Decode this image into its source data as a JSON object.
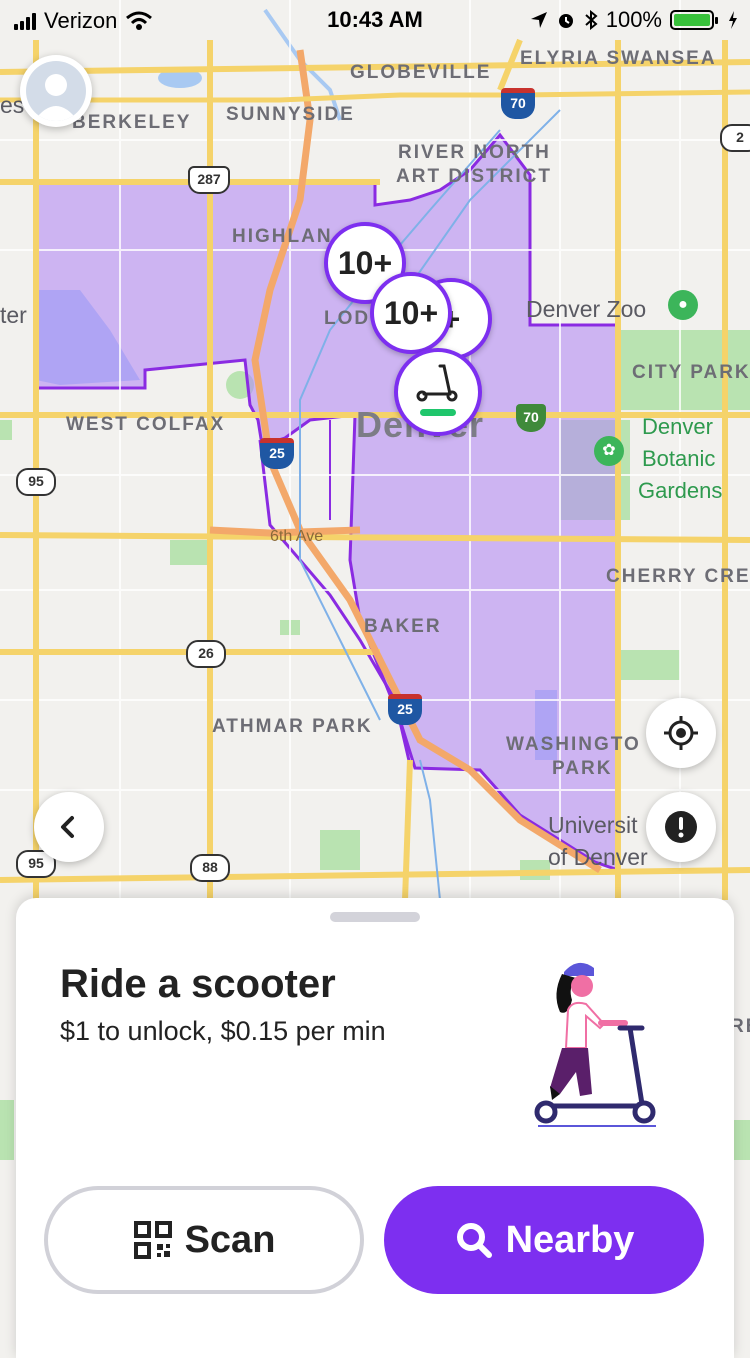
{
  "status_bar": {
    "carrier": "Verizon",
    "time": "10:43 AM",
    "battery_percent": "100%",
    "battery_level": 1.0,
    "icons": [
      "signal-icon",
      "wifi-icon",
      "location-arrow-icon",
      "alarm-icon",
      "bluetooth-icon",
      "battery-icon",
      "charging-icon"
    ]
  },
  "map": {
    "labels": {
      "globeville": "GLOBEVILLE",
      "elyria": "ELYRIA SWANSEA",
      "sunnyside": "SUNNYSIDE",
      "berkeley": "BERKELEY",
      "es": "es",
      "river_north_1": "RIVER NORTH",
      "river_north_2": "ART DISTRICT",
      "highland": "HIGHLAN",
      "lodo": "LOD",
      "ter": "ter",
      "denver_zoo": "Denver Zoo",
      "city_park": "CITY PARK",
      "west_colfax": "WEST COLFAX",
      "denver": "Denver",
      "botanic_1": "Denver",
      "botanic_2": "Botanic",
      "botanic_3": "Gardens",
      "sixth_ave": "6th Ave",
      "cherry_creek": "CHERRY CRE",
      "baker": "BAKER",
      "athmar_park": "ATHMAR PARK",
      "washington_1": "WASHINGTO",
      "washington_2": "PARK",
      "university_1": "Universit",
      "university_2": "of Denver",
      "edge_re": "RE"
    },
    "shields": {
      "us287": "287",
      "i70_top": "70",
      "i70_mid": "70",
      "i25_top": "25",
      "i25_bottom": "25",
      "sh95_top": "95",
      "sh95_bottom": "95",
      "sh26": "26",
      "sh88": "88",
      "sh2": "2"
    },
    "clusters": [
      "10+",
      "10+",
      "+"
    ],
    "zone_color": "#b48cf5",
    "zone_border": "#8a2be2"
  },
  "sheet": {
    "title": "Ride a scooter",
    "subtitle": "$1 to unlock, $0.15 per min",
    "scan_label": "Scan",
    "nearby_label": "Nearby"
  },
  "colors": {
    "accent": "#7d2ff0",
    "scooter_available": "#1fc66c"
  }
}
